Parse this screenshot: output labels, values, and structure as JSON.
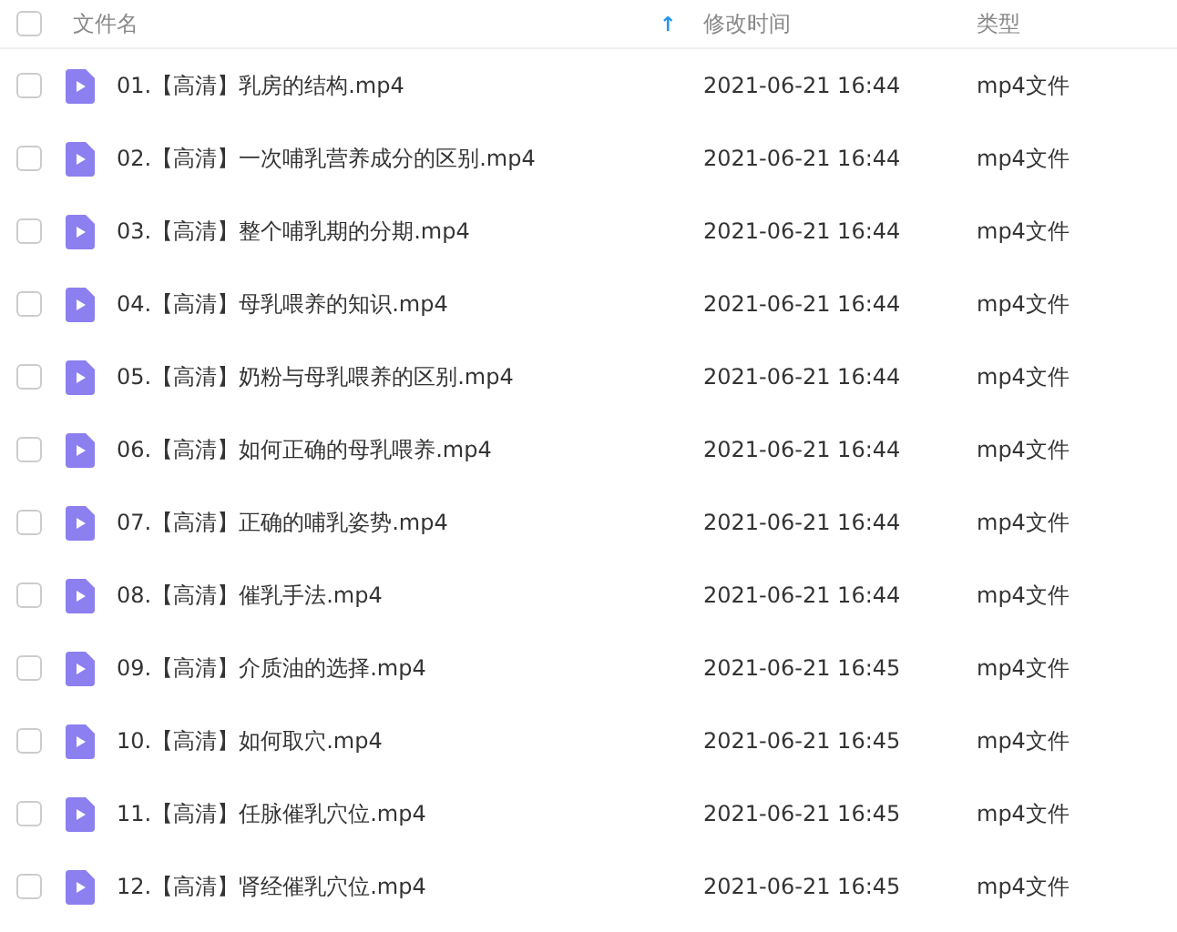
{
  "header": {
    "checked": false,
    "name": "文件名",
    "sort_arrow": "↑",
    "modified": "修改时间",
    "type": "类型"
  },
  "files": [
    {
      "name": "01.【高清】乳房的结构.mp4",
      "modified": "2021-06-21 16:44",
      "type": "mp4文件",
      "checked": false
    },
    {
      "name": "02.【高清】一次哺乳营养成分的区别.mp4",
      "modified": "2021-06-21 16:44",
      "type": "mp4文件",
      "checked": false
    },
    {
      "name": "03.【高清】整个哺乳期的分期.mp4",
      "modified": "2021-06-21 16:44",
      "type": "mp4文件",
      "checked": false
    },
    {
      "name": "04.【高清】母乳喂养的知识.mp4",
      "modified": "2021-06-21 16:44",
      "type": "mp4文件",
      "checked": false
    },
    {
      "name": "05.【高清】奶粉与母乳喂养的区别.mp4",
      "modified": "2021-06-21 16:44",
      "type": "mp4文件",
      "checked": false
    },
    {
      "name": "06.【高清】如何正确的母乳喂养.mp4",
      "modified": "2021-06-21 16:44",
      "type": "mp4文件",
      "checked": false
    },
    {
      "name": "07.【高清】正确的哺乳姿势.mp4",
      "modified": "2021-06-21 16:44",
      "type": "mp4文件",
      "checked": false
    },
    {
      "name": "08.【高清】催乳手法.mp4",
      "modified": "2021-06-21 16:44",
      "type": "mp4文件",
      "checked": false
    },
    {
      "name": "09.【高清】介质油的选择.mp4",
      "modified": "2021-06-21 16:45",
      "type": "mp4文件",
      "checked": false
    },
    {
      "name": "10.【高清】如何取穴.mp4",
      "modified": "2021-06-21 16:45",
      "type": "mp4文件",
      "checked": false
    },
    {
      "name": "11.【高清】任脉催乳穴位.mp4",
      "modified": "2021-06-21 16:45",
      "type": "mp4文件",
      "checked": false
    },
    {
      "name": "12.【高清】肾经催乳穴位.mp4",
      "modified": "2021-06-21 16:45",
      "type": "mp4文件",
      "checked": false
    }
  ]
}
